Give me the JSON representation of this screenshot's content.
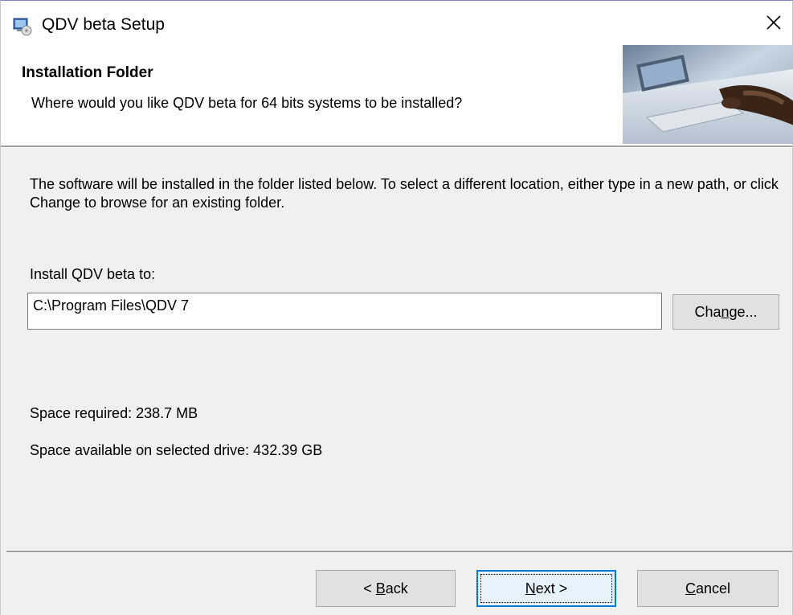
{
  "window": {
    "title": "QDV beta Setup",
    "close_glyph": "✕"
  },
  "header": {
    "title": "Installation Folder",
    "subtitle": "Where would you like QDV beta for 64 bits systems to be installed?"
  },
  "body": {
    "description": "The software will be installed in the folder listed below. To select a different location, either type in a new path, or click Change to browse for an existing folder.",
    "install_label": "Install QDV beta to:",
    "install_path": "C:\\Program Files\\QDV 7",
    "change_button": {
      "prefix": "Cha",
      "mnemonic": "n",
      "suffix": "ge..."
    },
    "space_required": "Space required: 238.7 MB",
    "space_available": "Space available on selected drive: 432.39 GB"
  },
  "footer": {
    "back_button": {
      "prefix": "< ",
      "mnemonic": "B",
      "suffix": "ack"
    },
    "next_button": {
      "prefix": "",
      "mnemonic": "N",
      "suffix": "ext >"
    },
    "cancel_button": {
      "prefix": "",
      "mnemonic": "C",
      "suffix": "ancel"
    }
  },
  "icons": {
    "app": "installer-icon",
    "close": "close-icon",
    "banner": "banner-image"
  },
  "colors": {
    "body_bg": "#f0f0f0",
    "button_bg": "#e1e1e1",
    "default_button_border": "#0078d7",
    "default_button_bg": "#e5f1fb"
  }
}
